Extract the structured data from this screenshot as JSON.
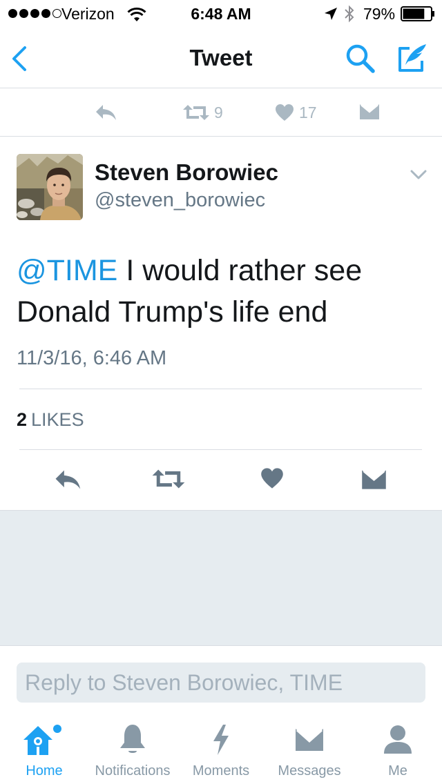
{
  "colors": {
    "accent": "#1da1f2",
    "mention": "#1b95e0",
    "muted": "#657786",
    "icon_gray": "#aab8c2",
    "separator": "#e6ecf0"
  },
  "status_bar": {
    "carrier": "Verizon",
    "time": "6:48 AM",
    "battery": "79%",
    "battery_level": 0.79,
    "signal_bars_filled": 4,
    "signal_bars_total": 5
  },
  "nav": {
    "title": "Tweet",
    "back_icon": "chevron-left-icon",
    "search_icon": "search-icon",
    "compose_icon": "compose-icon"
  },
  "top_actions": {
    "retweets": "9",
    "likes": "17"
  },
  "tweet": {
    "name": "Steven Borowiec",
    "handle": "@steven_borowiec",
    "mention": "@TIME",
    "text": " I would rather see Donald Trump's life end",
    "timestamp": "11/3/16, 6:46 AM",
    "likes_count": "2",
    "likes_label": "LIKES"
  },
  "reply": {
    "placeholder": "Reply to Steven Borowiec, TIME"
  },
  "tabs": [
    {
      "label": "Home",
      "icon": "home-icon",
      "active": true,
      "badge": true
    },
    {
      "label": "Notifications",
      "icon": "bell-icon"
    },
    {
      "label": "Moments",
      "icon": "lightning-icon"
    },
    {
      "label": "Messages",
      "icon": "envelope-icon"
    },
    {
      "label": "Me",
      "icon": "person-icon"
    }
  ]
}
